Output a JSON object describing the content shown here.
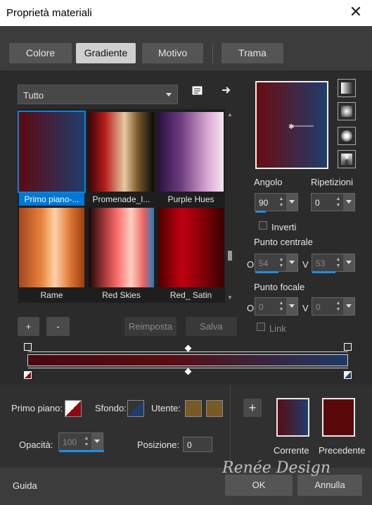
{
  "window": {
    "title": "Proprietà materiali"
  },
  "tabs": [
    {
      "label": "Colore"
    },
    {
      "label": "Gradiente",
      "active": true
    },
    {
      "label": "Motivo"
    },
    {
      "label": "Trama"
    }
  ],
  "category": {
    "selected": "Tutto"
  },
  "gradients": [
    {
      "name": "Primo piano-...",
      "selected": true
    },
    {
      "name": "Promenade_I..."
    },
    {
      "name": "Purple Hues"
    },
    {
      "name": "Rame"
    },
    {
      "name": "Red Skies"
    },
    {
      "name": "Red_ Satin"
    }
  ],
  "gallery_buttons": {
    "add": "+",
    "remove": "-",
    "reset": "Reimposta",
    "save": "Salva"
  },
  "angle": {
    "label": "Angolo",
    "value": "90"
  },
  "repeats": {
    "label": "Ripetizioni",
    "value": "0"
  },
  "invert": {
    "label": "Inverti",
    "checked": false
  },
  "center_point": {
    "label": "Punto centrale",
    "o_label": "O",
    "o_value": "54",
    "v_label": "V",
    "v_value": "53"
  },
  "focal_point": {
    "label": "Punto focale",
    "o_label": "O",
    "o_value": "0",
    "v_label": "V",
    "v_value": "0"
  },
  "link": {
    "label": "Link",
    "checked": false
  },
  "materials": {
    "foreground_label": "Primo piano:",
    "background_label": "Sfondo:",
    "user_label": "Utente:",
    "opacity_label": "Opacità:",
    "opacity_value": "100",
    "position_label": "Posizione:",
    "position_value": "0"
  },
  "compare": {
    "add": "+",
    "current_label": "Corrente",
    "previous_label": "Precedente"
  },
  "footer": {
    "help": "Guida",
    "ok": "OK",
    "cancel": "Annulla"
  },
  "watermark": "Renée Design",
  "colors": {
    "gradient_start": "#5a0c14",
    "gradient_end": "#1f3d6b",
    "user_color": "#7a5a24",
    "previous_color": "#5a0808",
    "accent": "#0078d7"
  }
}
